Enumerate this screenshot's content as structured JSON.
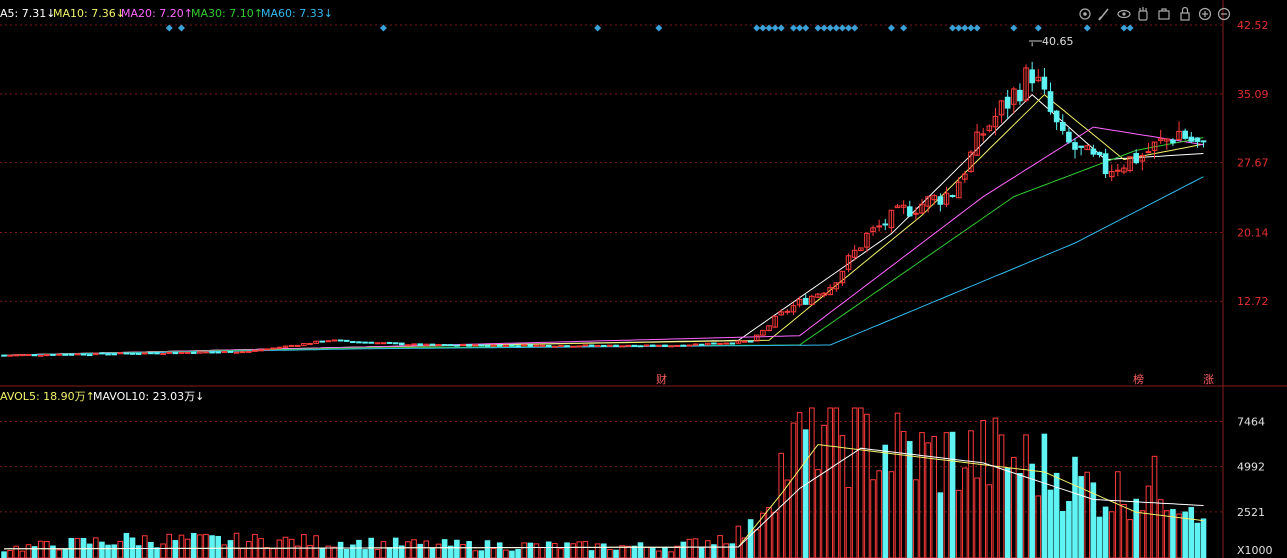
{
  "colors": {
    "up": "#ff3b3b",
    "down": "#5ff3f3",
    "grid": "#7a1a1a",
    "axis": "#8a1c1c",
    "price_tick": "#e03030",
    "vol_tick": "#e0e0e0",
    "marker": "#3aa0d8",
    "ma5": "#ffffff",
    "ma10": "#f2f26a",
    "ma20": "#ff66ff",
    "ma30": "#33cc33",
    "ma60": "#33bbee",
    "mavol5": "#f2f26a",
    "mavol10": "#ffffff"
  },
  "legend_price": {
    "ma5": "A5: 7.31↓",
    "ma10": "MA10: 7.36↓",
    "ma20": "MA20: 7.20↑",
    "ma30": "MA30: 7.10↑",
    "ma60": "MA60: 7.33↓"
  },
  "legend_volume": {
    "mavol5": "AVOL5: 18.90万↑",
    "mavol10": "MAVOL10: 23.03万↓"
  },
  "toolbar_icons": [
    "settings-icon",
    "brush-icon",
    "eye-icon",
    "hand-icon",
    "bag-icon",
    "lock-icon",
    "zoom-in-icon",
    "zoom-out-icon"
  ],
  "annotations": {
    "max_label": "40.65",
    "cai": "财",
    "bang": "榜",
    "zhang": "涨"
  },
  "chart_data": [
    {
      "type": "candlestick",
      "title": "",
      "y_ticks": [
        "42.52",
        "35.09",
        "27.67",
        "20.14",
        "12.72"
      ],
      "ylim": [
        5.3,
        42.52
      ],
      "grid": true,
      "max_value": 40.65,
      "bars": 197,
      "close_key_points": [
        [
          0,
          6.9
        ],
        [
          40,
          7.3
        ],
        [
          53,
          8.5
        ],
        [
          68,
          8.0
        ],
        [
          108,
          7.9
        ],
        [
          122,
          8.4
        ],
        [
          128,
          11.8
        ],
        [
          135,
          14.4
        ],
        [
          141,
          19.8
        ],
        [
          147,
          22.5
        ],
        [
          155,
          24.5
        ],
        [
          160,
          31.0
        ],
        [
          168,
          37.5
        ],
        [
          173,
          30.0
        ],
        [
          180,
          27.0
        ],
        [
          186,
          28.5
        ],
        [
          192,
          31.0
        ],
        [
          197,
          28.6
        ]
      ],
      "series": [
        {
          "name": "MA5",
          "values_key": [
            [
              0,
              6.9
            ],
            [
              60,
              7.8
            ],
            [
              120,
              8.5
            ],
            [
              145,
              20.0
            ],
            [
              168,
              35.0
            ],
            [
              180,
              28.0
            ],
            [
              197,
              28.7
            ]
          ]
        },
        {
          "name": "MA10",
          "values_key": [
            [
              0,
              6.9
            ],
            [
              60,
              7.8
            ],
            [
              125,
              8.5
            ],
            [
              150,
              22.0
            ],
            [
              170,
              35.0
            ],
            [
              183,
              28.0
            ],
            [
              197,
              29.8
            ]
          ]
        },
        {
          "name": "MA20",
          "values_key": [
            [
              0,
              6.9
            ],
            [
              60,
              7.8
            ],
            [
              130,
              9.0
            ],
            [
              160,
              24.0
            ],
            [
              178,
              31.5
            ],
            [
              197,
              29.5
            ]
          ]
        },
        {
          "name": "MA30",
          "values_key": [
            [
              0,
              6.9
            ],
            [
              60,
              7.7
            ],
            [
              130,
              8.0
            ],
            [
              165,
              24.0
            ],
            [
              185,
              29.0
            ],
            [
              197,
              30.5
            ]
          ]
        },
        {
          "name": "MA60",
          "values_key": [
            [
              0,
              6.9
            ],
            [
              60,
              7.6
            ],
            [
              135,
              8.0
            ],
            [
              175,
              19.0
            ],
            [
              197,
              26.5
            ]
          ]
        }
      ]
    },
    {
      "type": "bar",
      "title": "",
      "y_ticks": [
        "7464",
        "4992",
        "2521"
      ],
      "unit_label": "X1000",
      "ylim": [
        0,
        8200
      ],
      "grid": true,
      "volume_key_points": [
        [
          0,
          500
        ],
        [
          20,
          1000
        ],
        [
          50,
          900
        ],
        [
          70,
          700
        ],
        [
          110,
          600
        ],
        [
          122,
          1500
        ],
        [
          126,
          4500
        ],
        [
          133,
          7500
        ],
        [
          140,
          6500
        ],
        [
          150,
          5500
        ],
        [
          162,
          5500
        ],
        [
          170,
          5000
        ],
        [
          180,
          3500
        ],
        [
          190,
          4000
        ],
        [
          197,
          2800
        ]
      ],
      "series": [
        {
          "name": "MAVOL5",
          "values_key": [
            [
              0,
              500
            ],
            [
              120,
              600
            ],
            [
              127,
              3500
            ],
            [
              133,
              6200
            ],
            [
              150,
              5500
            ],
            [
              170,
              4700
            ],
            [
              185,
              2500
            ],
            [
              197,
              2000
            ]
          ]
        },
        {
          "name": "MAVOL10",
          "values_key": [
            [
              0,
              500
            ],
            [
              120,
              600
            ],
            [
              130,
              3800
            ],
            [
              140,
              6000
            ],
            [
              160,
              5200
            ],
            [
              178,
              3200
            ],
            [
              197,
              2850
            ]
          ]
        }
      ]
    }
  ]
}
